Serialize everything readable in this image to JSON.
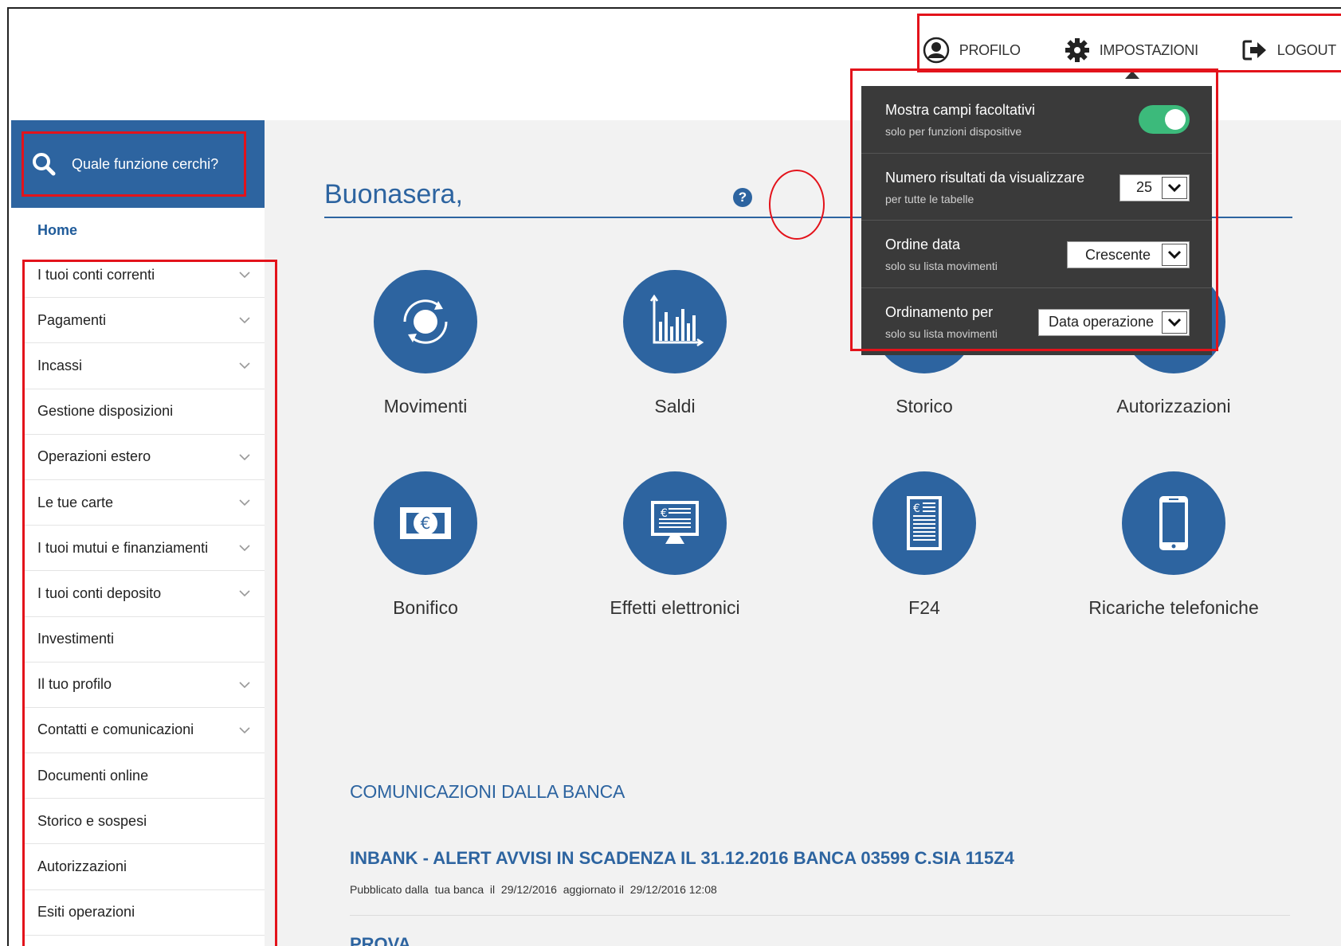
{
  "topnav": {
    "profilo": "PROFILO",
    "impostazioni": "IMPOSTAZIONI",
    "logout": "LOGOUT"
  },
  "sidebar": {
    "search_placeholder": "Quale funzione cerchi?",
    "home": "Home",
    "items": [
      {
        "label": "I tuoi conti correnti",
        "expandable": true
      },
      {
        "label": "Pagamenti",
        "expandable": true
      },
      {
        "label": "Incassi",
        "expandable": true
      },
      {
        "label": "Gestione disposizioni",
        "expandable": false
      },
      {
        "label": "Operazioni estero",
        "expandable": true
      },
      {
        "label": "Le tue carte",
        "expandable": true
      },
      {
        "label": "I tuoi mutui e finanziamenti",
        "expandable": true
      },
      {
        "label": "I tuoi conti deposito",
        "expandable": true
      },
      {
        "label": "Investimenti",
        "expandable": false
      },
      {
        "label": "Il tuo profilo",
        "expandable": true
      },
      {
        "label": "Contatti e comunicazioni",
        "expandable": true
      },
      {
        "label": "Documenti online",
        "expandable": false
      },
      {
        "label": "Storico e sospesi",
        "expandable": false
      },
      {
        "label": "Autorizzazioni",
        "expandable": false
      },
      {
        "label": "Esiti operazioni",
        "expandable": false
      }
    ]
  },
  "main": {
    "greeting": "Buonasera,",
    "help": "?",
    "tiles": [
      {
        "label": "Movimenti",
        "icon": "refresh-circle-icon"
      },
      {
        "label": "Saldi",
        "icon": "bar-chart-icon"
      },
      {
        "label": "Storico",
        "icon": "history-icon"
      },
      {
        "label": "Autorizzazioni",
        "icon": "authorization-icon"
      },
      {
        "label": "Bonifico",
        "icon": "banknote-euro-icon"
      },
      {
        "label": "Effetti elettronici",
        "icon": "monitor-euro-icon"
      },
      {
        "label": "F24",
        "icon": "document-euro-icon"
      },
      {
        "label": "Ricariche telefoniche",
        "icon": "smartphone-icon"
      }
    ],
    "comunicazioni_title": "COMUNICAZIONI DALLA BANCA",
    "news": [
      {
        "title": "INBANK - ALERT AVVISI IN SCADENZA IL 31.12.2016 BANCA 03599 C.SIA 115Z4",
        "meta": "Pubblicato dalla  tua banca  il  29/12/2016  aggiornato il  29/12/2016 12:08"
      },
      {
        "title": "PROVA"
      }
    ]
  },
  "settings_popup": {
    "rows": [
      {
        "title": "Mostra campi facoltativi",
        "sub": "solo per funzioni dispositive",
        "control": "toggle",
        "on": true
      },
      {
        "title": "Numero risultati da visualizzare",
        "sub": "per tutte le tabelle",
        "control": "select",
        "value": "25"
      },
      {
        "title": "Ordine data",
        "sub": "solo su lista movimenti",
        "control": "select",
        "value": "Crescente"
      },
      {
        "title": "Ordinamento per",
        "sub": "solo su lista movimenti",
        "control": "select",
        "value": "Data operazione"
      }
    ]
  },
  "colors": {
    "brand_blue": "#2d64a0",
    "popup_bg": "#3a3a3a",
    "toggle_on": "#3cba7b",
    "annotation_red": "#e3131b",
    "main_bg": "#f2f2f2"
  }
}
